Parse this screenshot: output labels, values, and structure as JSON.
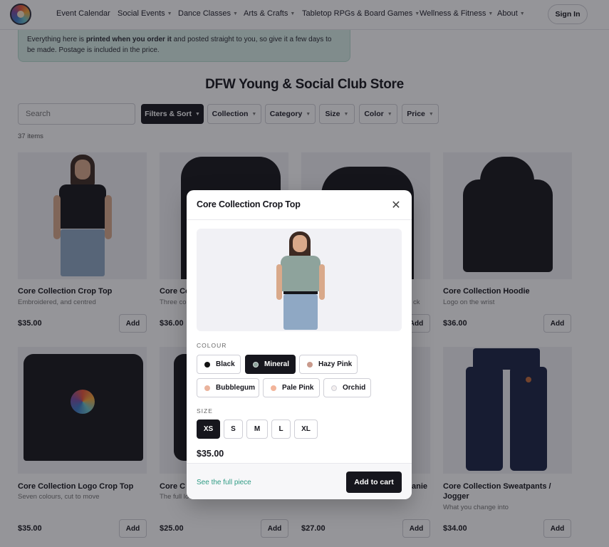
{
  "nav": {
    "items": [
      {
        "label": "Event Calendar",
        "dropdown": false
      },
      {
        "label": "Social Events",
        "dropdown": true
      },
      {
        "label": "Dance Classes",
        "dropdown": true
      },
      {
        "label": "Arts & Crafts",
        "dropdown": true
      },
      {
        "label": "Tabletop RPGs & Board Games",
        "dropdown": true
      },
      {
        "label": "Wellness & Fitness",
        "dropdown": true
      },
      {
        "label": "About",
        "dropdown": true
      }
    ],
    "signin_label": "Sign In"
  },
  "notice": {
    "text_before": "Everything here is ",
    "text_bold": "printed when you order it",
    "text_after": " and posted straight to you, so give it a few days to be made. Postage is included in the price."
  },
  "store": {
    "title": "DFW Young & Social Club Store",
    "search_placeholder": "Search",
    "filters": [
      {
        "label": "Filters & Sort"
      },
      {
        "label": "Collection"
      },
      {
        "label": "Category"
      },
      {
        "label": "Size"
      },
      {
        "label": "Color"
      },
      {
        "label": "Price"
      }
    ],
    "item_count": "37 items"
  },
  "products": [
    {
      "name": "Core Collection Crop Top",
      "desc": "Embroidered, and centred",
      "price": "$35.00",
      "add": "Add"
    },
    {
      "name": "Core Co",
      "desc": "Three co",
      "price": "$36.00",
      "add": "Add"
    },
    {
      "name": "",
      "desc": "ck",
      "price": "",
      "add": "Add"
    },
    {
      "name": "Core Collection Hoodie",
      "desc": "Logo on the wrist",
      "price": "$36.00",
      "add": "Add"
    },
    {
      "name": "Core Collection Logo Crop Top",
      "desc": "Seven colours, cut to move",
      "price": "$35.00",
      "add": "Add"
    },
    {
      "name": "Core C",
      "desc": "The full lo",
      "price": "$25.00",
      "add": "Add"
    },
    {
      "name": "anie",
      "desc": "",
      "price": "$27.00",
      "add": "Add"
    },
    {
      "name": "Core Collection Sweatpants / Jogger",
      "desc": "What you change into",
      "price": "$34.00",
      "add": "Add"
    }
  ],
  "modal": {
    "title": "Core Collection Crop Top",
    "colour_label": "COLOUR",
    "colours": [
      {
        "label": "Black",
        "swatch": "#111111"
      },
      {
        "label": "Mineral",
        "swatch": "#8ea39c"
      },
      {
        "label": "Hazy Pink",
        "swatch": "#c99a8c"
      },
      {
        "label": "Bubblegum",
        "swatch": "#eab39c"
      },
      {
        "label": "Pale Pink",
        "swatch": "#f2b49a"
      },
      {
        "label": "Orchid",
        "swatch": "#f3eeee"
      }
    ],
    "selected_colour": "Mineral",
    "size_label": "SIZE",
    "sizes": [
      "XS",
      "S",
      "M",
      "L",
      "XL"
    ],
    "selected_size": "XS",
    "price": "$35.00",
    "full_piece_link": "See the full piece",
    "add_to_cart": "Add to cart"
  },
  "colors": {
    "accent_dark": "#16161d",
    "notice_bg": "#d9efe7",
    "link_teal": "#2f9b84"
  }
}
